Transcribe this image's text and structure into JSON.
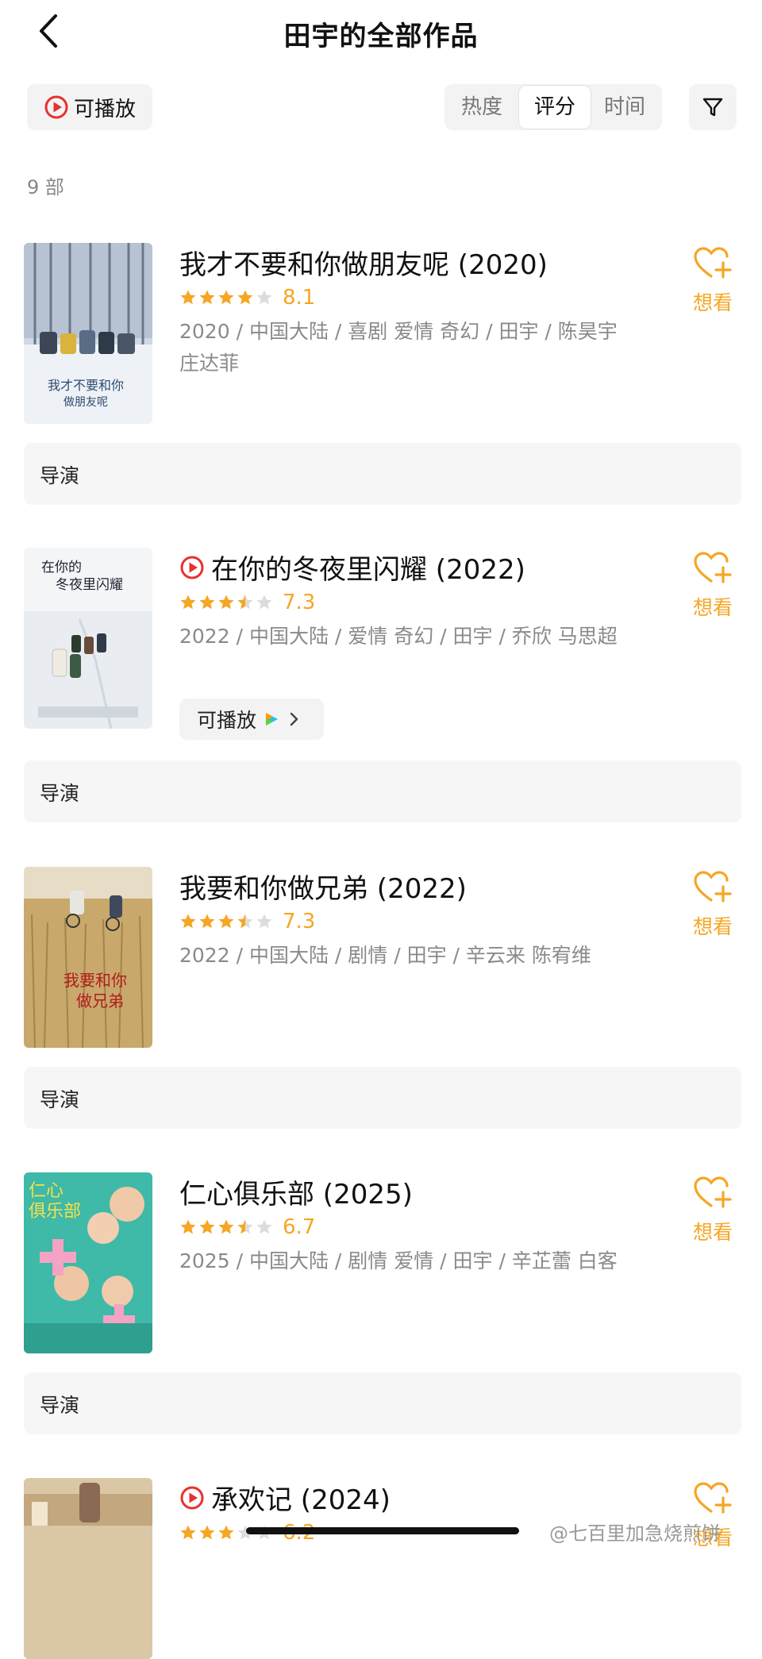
{
  "header": {
    "title": "田宇的全部作品"
  },
  "toolbar": {
    "playable_label": "可播放",
    "sort_options": [
      "热度",
      "评分",
      "时间"
    ],
    "sort_selected": "评分"
  },
  "count_label": "9 部",
  "want_label": "想看",
  "colors": {
    "accent": "#f5a623",
    "play_red": "#e8312f",
    "bar_bg": "#f6f6f6"
  },
  "works": [
    {
      "title": "我才不要和你做朋友呢 (2020)",
      "rating": "8.1",
      "stars": 4,
      "meta": "2020 / 中国大陆 / 喜剧 爱情 奇幻 / 田宇 / 陈昊宇 庄达菲",
      "role": "导演",
      "playable": false,
      "show_chip": false
    },
    {
      "title": "在你的冬夜里闪耀 (2022)",
      "rating": "7.3",
      "stars": 3.5,
      "meta": "2022 / 中国大陆 / 爱情 奇幻 / 田宇 / 乔欣 马思超",
      "role": "导演",
      "playable": true,
      "show_chip": true,
      "chip_label": "可播放"
    },
    {
      "title": "我要和你做兄弟 (2022)",
      "rating": "7.3",
      "stars": 3.5,
      "meta": "2022 / 中国大陆 / 剧情 / 田宇 / 辛云来 陈宥维",
      "role": "导演",
      "playable": false,
      "show_chip": false
    },
    {
      "title": "仁心俱乐部 (2025)",
      "rating": "6.7",
      "stars": 3.5,
      "meta": "2025 / 中国大陆 / 剧情 爱情 / 田宇 / 辛芷蕾 白客",
      "role": "导演",
      "playable": false,
      "show_chip": false
    },
    {
      "title": "承欢记 (2024)",
      "rating": "6.2",
      "stars": 3,
      "meta": "",
      "role": "",
      "playable": true,
      "show_chip": false
    }
  ],
  "watermark": "@七百里加急烧煎饼"
}
